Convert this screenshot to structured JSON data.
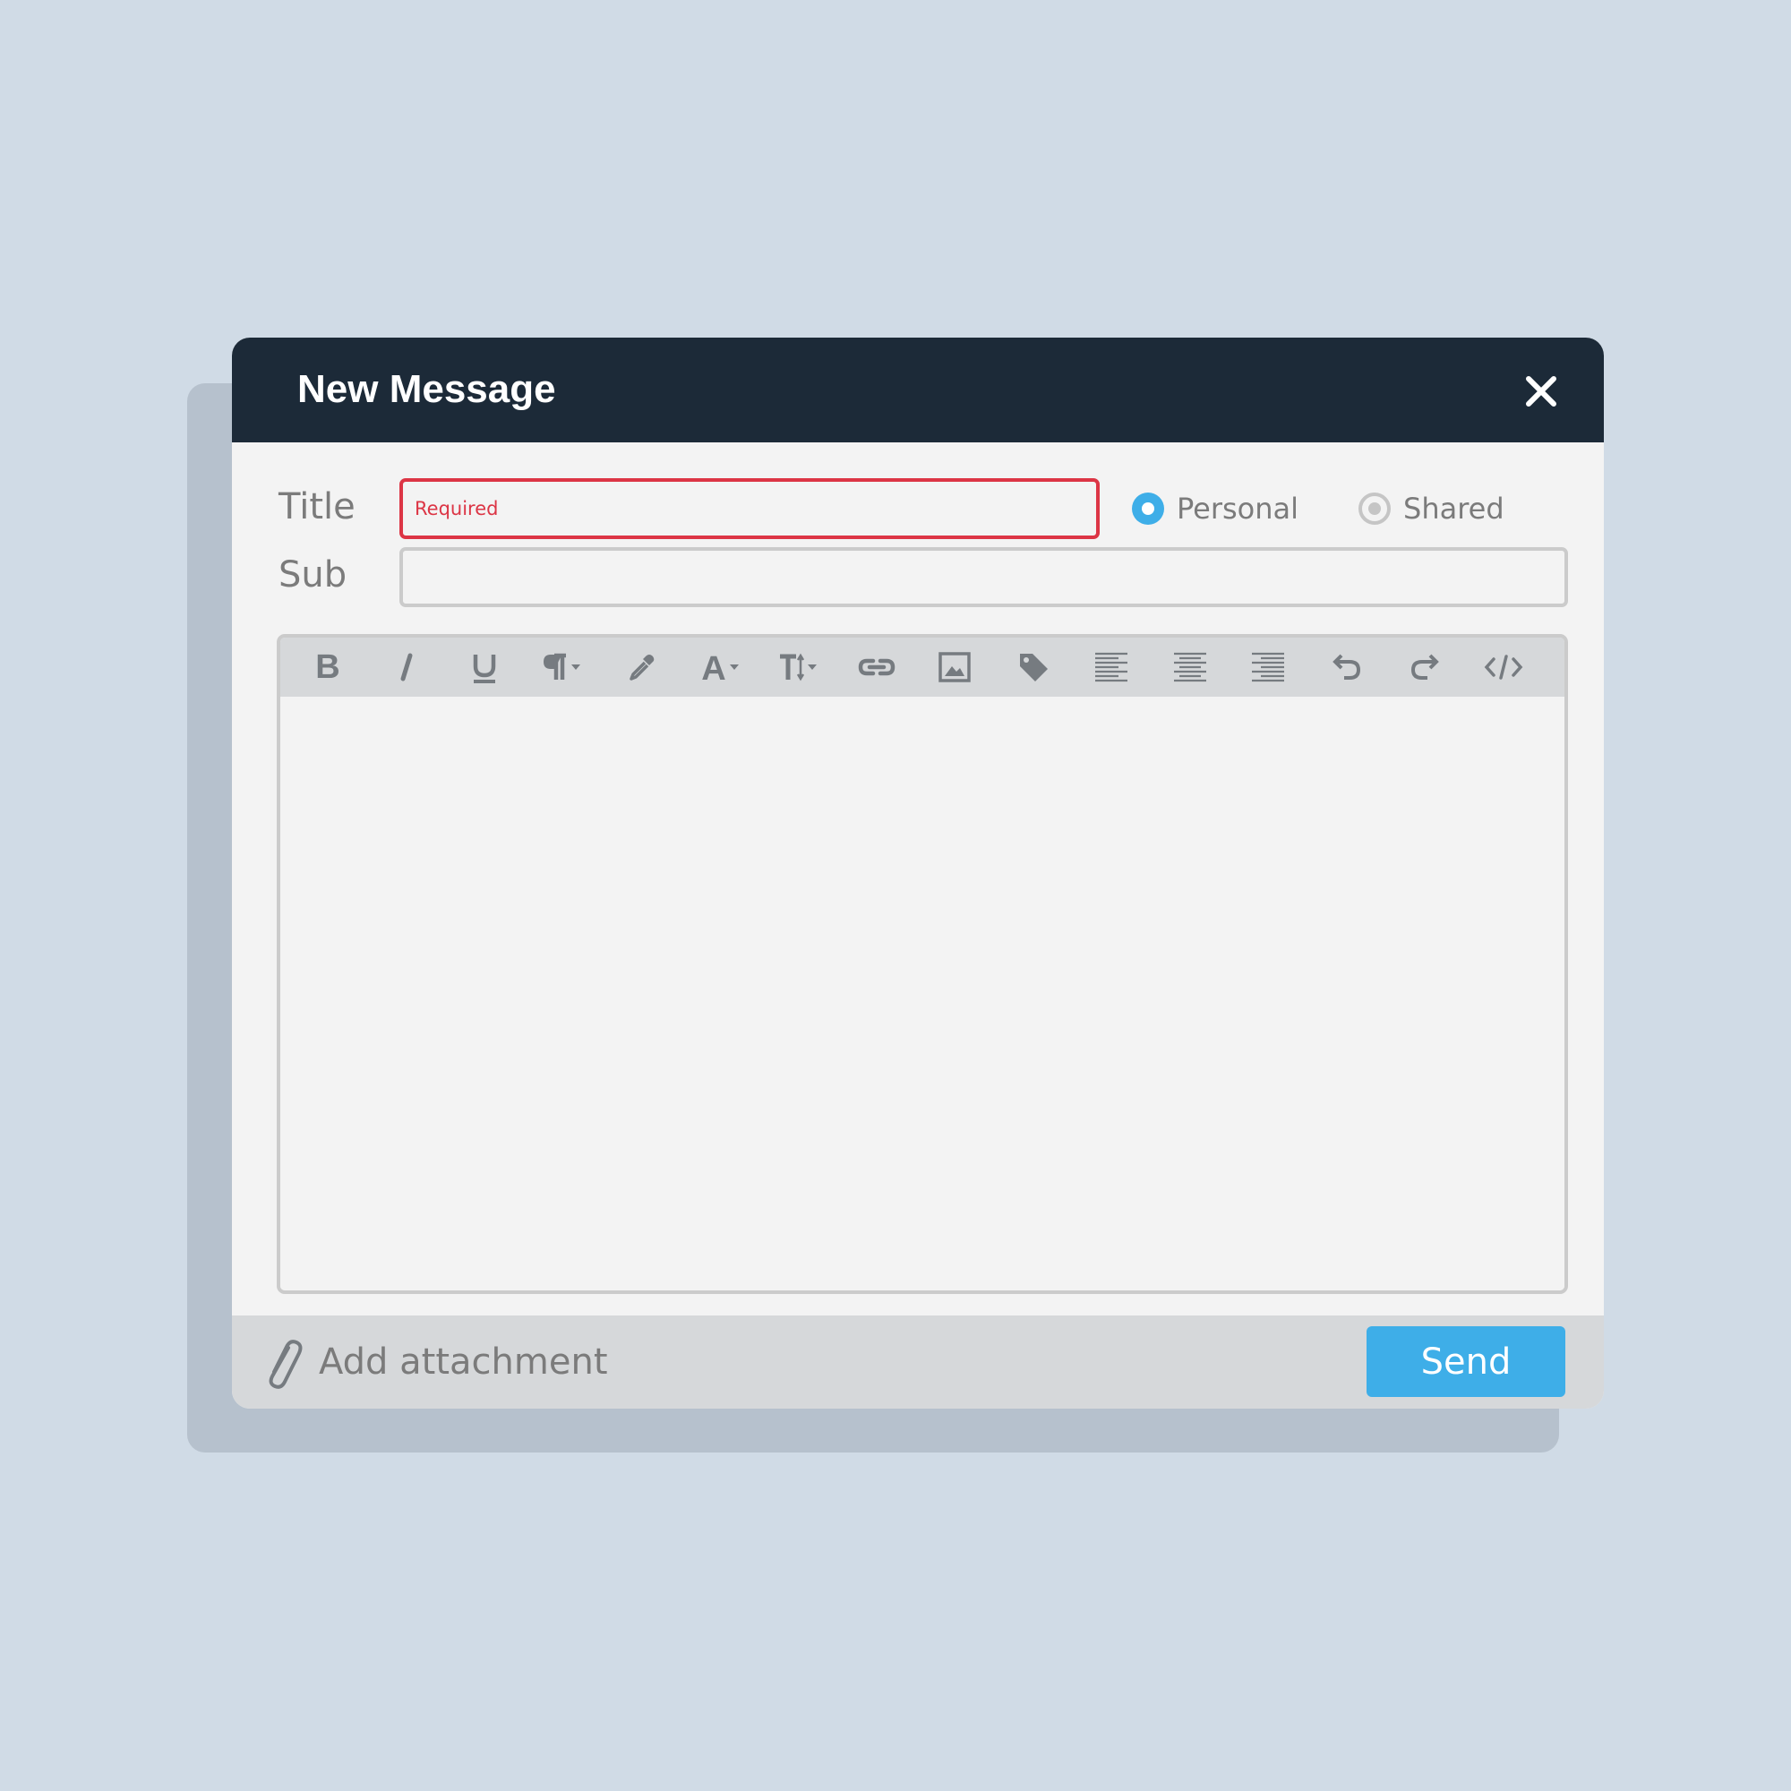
{
  "dialog": {
    "title": "New Message"
  },
  "form": {
    "title_label": "Title",
    "title_placeholder": "Required",
    "sub_label": "Sub",
    "sub_value": "",
    "visibility_options": [
      {
        "label": "Personal",
        "selected": true
      },
      {
        "label": "Shared",
        "selected": false
      }
    ]
  },
  "toolbar": {
    "tools": [
      "bold-icon",
      "italic-icon",
      "underline-icon",
      "paragraph-icon",
      "color-picker-icon",
      "font-family-icon",
      "font-size-icon",
      "link-icon",
      "image-icon",
      "tag-icon",
      "align-left-icon",
      "align-center-icon",
      "align-right-icon",
      "undo-icon",
      "redo-icon",
      "code-icon"
    ]
  },
  "footer": {
    "attachment_label": "Add attachment",
    "send_label": "Send"
  },
  "colors": {
    "background": "#d0dbe6",
    "header": "#1c2a38",
    "accent": "#3eaee8",
    "error": "#dc3545",
    "icon": "#767b80"
  }
}
